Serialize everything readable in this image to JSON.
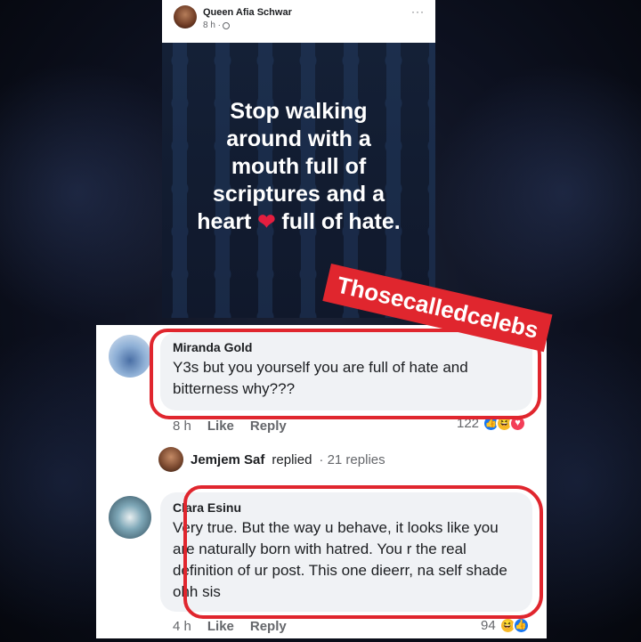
{
  "post": {
    "author": "Queen Afia Schwar",
    "time": "8 h ·",
    "more": "···",
    "quote_lines": [
      "Stop walking",
      "around with a",
      "mouth full of",
      "scriptures and a"
    ],
    "quote_last_before": "heart",
    "quote_last_after": "full of hate."
  },
  "watermark": "Thosecalledcelebs",
  "comments": [
    {
      "name": "Miranda Gold",
      "text": "Y3s but you yourself you are full of hate and bitterness why???",
      "time": "8 h",
      "like": "Like",
      "reply": "Reply",
      "reaction_count": "122"
    },
    {
      "name": "Clara Esinu",
      "text": "Very true. But the way u behave, it looks like you are naturally born with hatred. You r the real definition of ur post. This one dieerr, na self shade ohh sis",
      "time": "4 h",
      "like": "Like",
      "reply": "Reply",
      "reaction_count": "94"
    }
  ],
  "reply_thread": {
    "name": "Jemjem Saf",
    "text": "replied",
    "count": "· 21 replies"
  },
  "colors": {
    "accent_red": "#e0262e",
    "like_blue": "#1877f2",
    "bubble_bg": "#f0f2f5"
  }
}
